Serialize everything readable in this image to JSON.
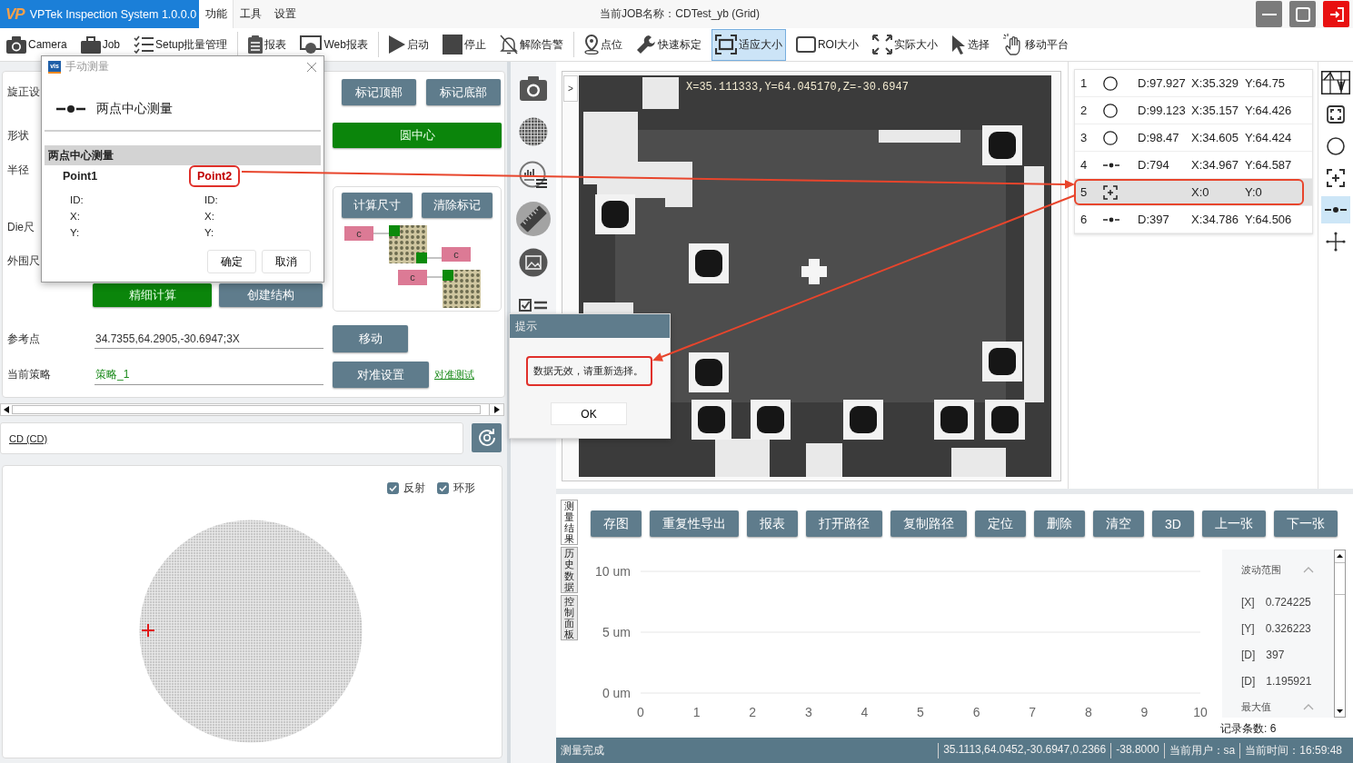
{
  "app": {
    "logo_text": "VP",
    "title": "VPTek Inspection System 1.0.0.0"
  },
  "menu": [
    {
      "label": "功能",
      "selected": true
    },
    {
      "label": "工具",
      "selected": false
    },
    {
      "label": "设置",
      "selected": false
    }
  ],
  "job_title": "当前JOB名称：CDTest_yb (Grid)",
  "toolbar": {
    "groups": [
      [
        {
          "label": "Camera",
          "selected": false
        },
        {
          "label": "Job",
          "selected": false
        },
        {
          "label": "Setup批量管理",
          "selected": false
        }
      ],
      [
        {
          "label": "报表",
          "selected": false
        },
        {
          "label": "Web报表",
          "selected": false
        }
      ],
      [
        {
          "label": "启动",
          "selected": false
        },
        {
          "label": "停止",
          "selected": false
        },
        {
          "label": "解除告警",
          "selected": false
        }
      ],
      [
        {
          "label": "点位",
          "selected": false
        },
        {
          "label": "快速标定",
          "selected": false
        },
        {
          "label": "适应大小",
          "selected": true
        },
        {
          "label": "ROI大小",
          "selected": false
        },
        {
          "label": "实际大小",
          "selected": false
        },
        {
          "label": "选择",
          "selected": false
        },
        {
          "label": "移动平台",
          "selected": false
        }
      ]
    ]
  },
  "settings_panel": {
    "labels": [
      "旋正设",
      "形状",
      "半径",
      "Die尺",
      "外围尺"
    ],
    "mark_buttons": [
      "标记顶部",
      "标记底部"
    ],
    "center_button": "圆中心",
    "structure_card": {
      "buttons": [
        "计算尺寸",
        "清除标记"
      ],
      "node_labels": [
        "c",
        "c",
        "c"
      ]
    },
    "calc_buttons": [
      {
        "label": "精细计算",
        "kind": "primary"
      },
      {
        "label": "创建结构",
        "kind": "secondary"
      }
    ],
    "reference_point": {
      "label": "参考点",
      "value": "34.7355,64.2905,-30.6947;3X",
      "button": "移动"
    },
    "strategy": {
      "label": "当前策略",
      "value": "策略_1",
      "button": "对准设置",
      "link": "对准测试"
    }
  },
  "cd_selector": {
    "value": "CD (CD)"
  },
  "wafer_panel": {
    "options": [
      {
        "label": "反射",
        "checked": true
      },
      {
        "label": "环形",
        "checked": true
      }
    ]
  },
  "manual_dialog": {
    "icon_text": "vis",
    "title": "手动测量",
    "heading": "两点中心测量",
    "group_title": "两点中心测量",
    "points": [
      {
        "name": "Point1",
        "highlighted": false,
        "fields": [
          "ID:",
          "X:",
          "Y:"
        ]
      },
      {
        "name": "Point2",
        "highlighted": true,
        "fields": [
          "ID:",
          "X:",
          "Y:"
        ]
      }
    ],
    "buttons": [
      "确定",
      "取消"
    ]
  },
  "tool_strip": [
    {
      "selected": false
    },
    {
      "selected": false
    },
    {
      "selected": false
    },
    {
      "selected": true
    },
    {
      "selected": false
    },
    {
      "selected": false
    }
  ],
  "viewer": {
    "toggle": ">",
    "overlay_text": "X=35.111333,Y=64.045170,Z=-30.6947"
  },
  "alert": {
    "title": "提示",
    "message": "数据无效，请重新选择。",
    "highlighted": true,
    "button": "OK"
  },
  "results": [
    {
      "index": "1",
      "kind": "circle",
      "d": "D:97.927",
      "x": "X:35.329",
      "y": "Y:64.75",
      "selected": false,
      "highlighted": false
    },
    {
      "index": "2",
      "kind": "circle",
      "d": "D:99.123",
      "x": "X:35.157",
      "y": "Y:64.426",
      "selected": false,
      "highlighted": false
    },
    {
      "index": "3",
      "kind": "circle",
      "d": "D:98.47",
      "x": "X:34.605",
      "y": "Y:64.424",
      "selected": false,
      "highlighted": false
    },
    {
      "index": "4",
      "kind": "two-point",
      "d": "D:794",
      "x": "X:34.967",
      "y": "Y:64.587",
      "selected": false,
      "highlighted": false
    },
    {
      "index": "5",
      "kind": "point",
      "x": "X:0",
      "y": "Y:0",
      "selected": true,
      "highlighted": true
    },
    {
      "index": "6",
      "kind": "two-point",
      "d": "D:397",
      "x": "X:34.786",
      "y": "Y:64.506",
      "selected": false,
      "highlighted": false
    }
  ],
  "side_tools": [
    {
      "selected": false
    },
    {
      "selected": false
    },
    {
      "selected": false
    },
    {
      "selected": false
    },
    {
      "selected": true
    },
    {
      "selected": false
    }
  ],
  "bottom_tabs": [
    {
      "label": "测量结果",
      "selected": true
    },
    {
      "label": "历史数据",
      "selected": false
    },
    {
      "label": "控制面板",
      "selected": false
    }
  ],
  "result_actions": [
    "存图",
    "重复性导出",
    "报表",
    "打开路径",
    "复制路径",
    "定位",
    "删除",
    "清空",
    "3D",
    "上一张",
    "下一张"
  ],
  "chart": {
    "chart_data": {
      "type": "line",
      "xlim": [
        0,
        10
      ],
      "ylim": [
        0,
        10
      ],
      "xticks": [
        0,
        1,
        2,
        3,
        4,
        5,
        6,
        7,
        8,
        9,
        10
      ],
      "yticks": [
        {
          "value": 0,
          "label": "0 um"
        },
        {
          "value": 5,
          "label": "5 um"
        },
        {
          "value": 10,
          "label": "10 um"
        }
      ]
    }
  },
  "stats": {
    "sections": [
      {
        "title": "波动范围",
        "expanded": true,
        "rows": [
          {
            "key": "[X]",
            "value": "0.724225"
          },
          {
            "key": "[Y]",
            "value": "0.326223"
          },
          {
            "key": "[D]",
            "value": "397"
          },
          {
            "key": "[D]",
            "value": "1.195921"
          }
        ]
      },
      {
        "title": "最大值",
        "expanded": true
      }
    ]
  },
  "record_count": "记录条数: 6",
  "status_bar": {
    "message": "测量完成",
    "items": [
      "35.1113,64.0452,-30.6947,0.2366",
      "-38.8000",
      "当前用户：sa",
      "当前时间：16:59:48"
    ]
  }
}
